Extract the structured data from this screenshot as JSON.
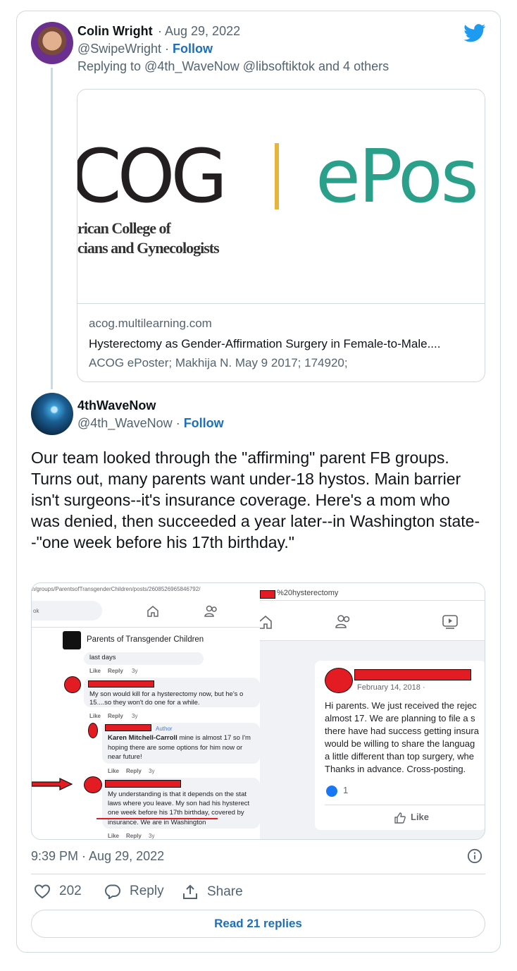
{
  "reply_tweet": {
    "author_name": "Colin Wright",
    "date": "· Aug 29, 2022",
    "handle": "@SwipeWright",
    "follow_label": "Follow",
    "replying_to": "Replying to @4th_WaveNow @libsoftiktok and 4 others",
    "link_card": {
      "image_text_big": "COG",
      "image_text_epos": "ePos",
      "image_sub_line1": "rican College of",
      "image_sub_line2": "cians and Gynecologists",
      "domain": "acog.multilearning.com",
      "title": "Hysterectomy as Gender-Affirmation Surgery in Female-to-Male....",
      "description": "ACOG ePoster; Makhija N. May 9 2017; 174920;"
    }
  },
  "main_tweet": {
    "author_name": "4thWaveNow",
    "handle": "@4th_WaveNow",
    "follow_label": "Follow",
    "text": "Our team looked through the \"affirming\" parent FB groups. Turns out, many parents want under-18 hystos. Main barrier isn't surgeons--it's insurance coverage. Here's a mom who was denied, then succeeded a year later--in Washington state--\"one week before his 17th birthday.\"",
    "timestamp": "9:39 PM · Aug 29, 2022",
    "likes": "202",
    "reply_label": "Reply",
    "share_label": "Share",
    "read_replies_label": "Read 21 replies"
  },
  "screenshot": {
    "url_left": "n/groups/ParentsofTransgenderChildren/posts/2608526965846792/",
    "search_stub": "ok",
    "url_right": "%20hysterectomy",
    "group_name": "Parents of Transgender Children",
    "c0_text": "last days",
    "like": "Like",
    "reply": "Reply",
    "age": "3y",
    "c1_text_1": "My son would kill for a hysterectomy now, but he's o",
    "c1_text_2": "15....so they won't do one for a while.",
    "author_badge": "Author",
    "c2_name": "Karen Mitchell-Carroll",
    "c2_text_1": "mine is almost 17 so I'm",
    "c2_text_2": "hoping there are some options for him now or",
    "c2_text_3": "near future!",
    "c3_text_1": "My understanding is that it depends on the stat",
    "c3_text_2": "laws where you leave. My son had his hysterect",
    "c3_text_3": "one week before his 17th birthday, covered by",
    "c3_text_4": "insurance. We are in Washington",
    "post_date": "February 14, 2018 ·",
    "post_lines": [
      "Hi parents. We just received the rejec",
      "almost 17. We are planning to file a s",
      "there have had success getting insura",
      "would be willing to share the languag",
      "a little different than top surgery, whe",
      "Thanks in advance. Cross-posting."
    ],
    "reaction_count": "1",
    "post_like": "Like"
  },
  "colors": {
    "accent": "#1d6fb8",
    "twitter_blue": "#1d9bf0",
    "muted": "#536471",
    "border": "#cfd9de",
    "fb_red_redaction": "#e31b23",
    "acog_green": "#2aa08a",
    "acog_gold": "#e5b63b"
  },
  "icons": [
    "twitter-bird-icon",
    "info-icon",
    "heart-icon",
    "reply-bubble-icon",
    "share-icon",
    "home-icon",
    "friends-icon",
    "watch-icon",
    "like-thumb-icon",
    "arrow-icon"
  ]
}
